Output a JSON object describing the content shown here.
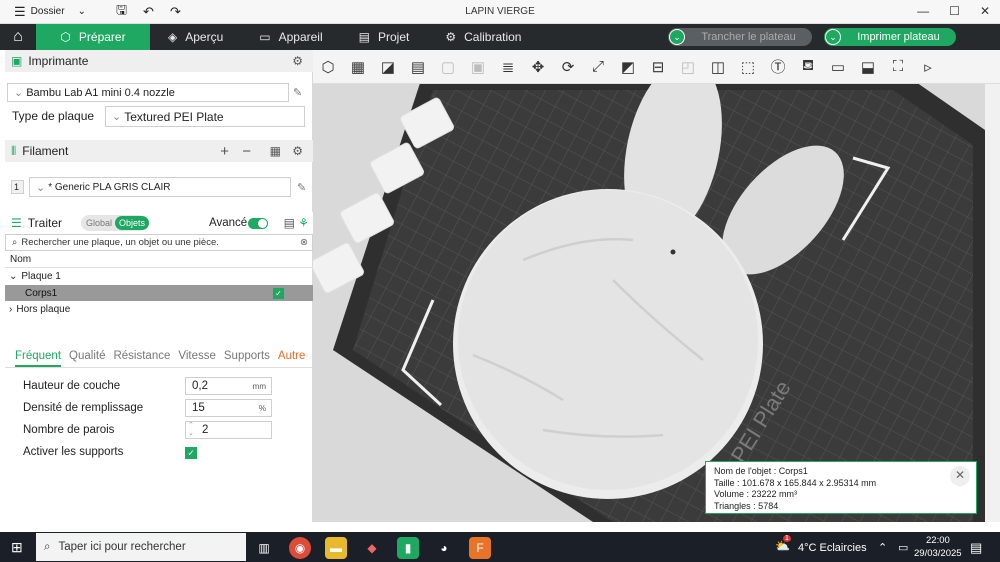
{
  "titlebar": {
    "menu_label": "Dossier",
    "app_title": "LAPIN VIERGE",
    "icons": [
      "hamburger-icon",
      "chevron-down-icon",
      "save-icon",
      "undo-icon",
      "redo-icon"
    ]
  },
  "mainbar": {
    "tabs": [
      {
        "label": "Préparer",
        "icon": "cube-icon"
      },
      {
        "label": "Aperçu",
        "icon": "layers-icon"
      },
      {
        "label": "Appareil",
        "icon": "monitor-icon"
      },
      {
        "label": "Projet",
        "icon": "document-icon"
      },
      {
        "label": "Calibration",
        "icon": "gear-icon"
      }
    ],
    "slice_label": "Trancher le plateau",
    "print_label": "Imprimer plateau",
    "accent": "#1ea862"
  },
  "printer": {
    "title": "Imprimante",
    "name": "Bambu Lab A1 mini 0.4 nozzle",
    "plate_type_label": "Type de plaque",
    "plate_type": "Textured PEI Plate"
  },
  "filament": {
    "title": "Filament",
    "slot": "1",
    "name": "* Generic PLA GRIS CLAIR"
  },
  "process": {
    "title": "Traiter",
    "toggle_global": "Global",
    "toggle_objects": "Objets",
    "advanced_label": "Avancé",
    "search_placeholder": "Rechercher une plaque, un objet ou une pièce.",
    "tree_header": "Nom",
    "tree": {
      "plate": "Plaque 1",
      "object": "Corps1",
      "outside": "Hors plaque"
    },
    "tabs": [
      "Fréquent",
      "Qualité",
      "Résistance",
      "Vitesse",
      "Supports",
      "Autre"
    ],
    "params": {
      "layer_height_label": "Hauteur de couche",
      "layer_height": "0,2",
      "layer_height_unit": "mm",
      "infill_label": "Densité de remplissage",
      "infill": "15",
      "infill_unit": "%",
      "walls_label": "Nombre de parois",
      "walls": "2",
      "supports_label": "Activer les supports"
    }
  },
  "viewport": {
    "plate_text": "d PEI Plate",
    "info": {
      "name": "Nom de l'objet : Corps1",
      "size": "Taille : 101.678 x 165.844 x 2.95314 mm",
      "volume": "Volume : 23222 mm³",
      "triangles": "Triangles : 5784"
    }
  },
  "taskbar": {
    "search_placeholder": "Taper ici pour rechercher",
    "weather": "4°C  Eclaircies",
    "time": "22:00",
    "date": "29/03/2025",
    "notification_count": "1"
  }
}
